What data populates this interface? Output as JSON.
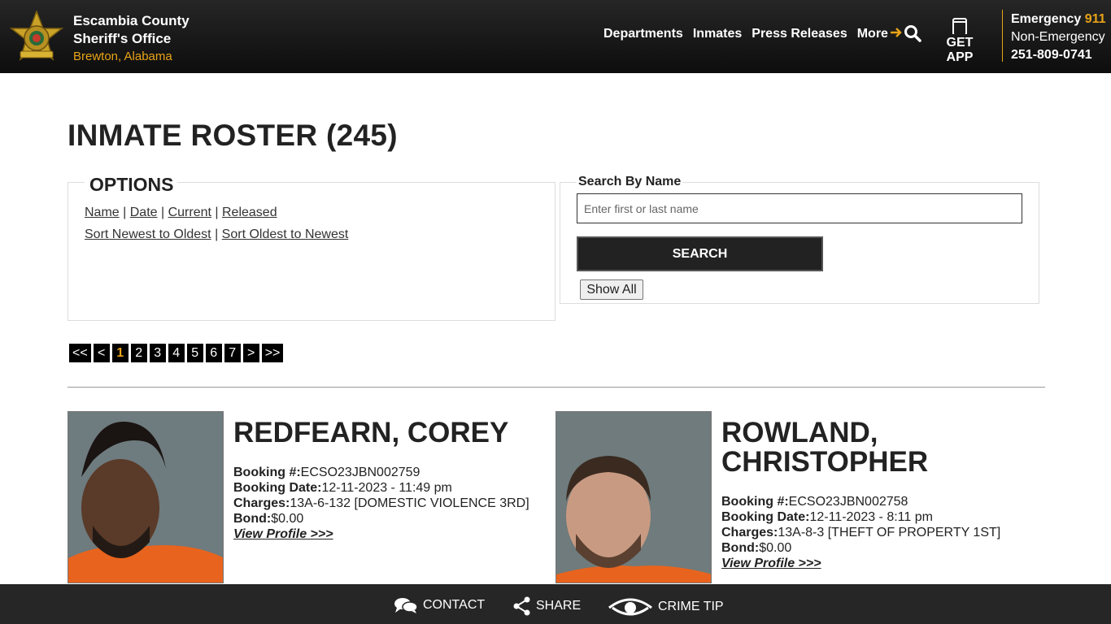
{
  "header": {
    "brand_line1": "Escambia County",
    "brand_line2": "Sheriff's Office",
    "brand_line3": "Brewton, Alabama",
    "nav": [
      "Departments",
      "Inmates",
      "Press Releases",
      "More"
    ],
    "get_app": "GET APP",
    "emergency_label": "Emergency",
    "emergency_number": "911",
    "non_emergency_label": "Non-Emergency",
    "non_emergency_number": "251-809-0741",
    "accent_color": "#e8a317"
  },
  "main": {
    "title": "INMATE ROSTER (245)",
    "options_title": "OPTIONS",
    "sort_links": [
      "Name",
      "Date",
      "Current",
      "Released"
    ],
    "order_links": [
      "Sort Newest to Oldest",
      "Sort Oldest to Newest"
    ],
    "search_label": "Search By Name",
    "search_placeholder": "Enter first or last name",
    "search_button": "SEARCH",
    "show_all_button": "Show All",
    "pager": [
      "<<",
      "<",
      "1",
      "2",
      "3",
      "4",
      "5",
      "6",
      "7",
      ">",
      ">>"
    ],
    "current_page": "1"
  },
  "inmates": [
    {
      "name": "REDFEARN, COREY",
      "booking_label": "Booking #:",
      "booking_no": "ECSO23JBN002759",
      "date_label": "Booking Date:",
      "booking_date": "12-11-2023 - 11:49 pm",
      "charges_label": "Charges:",
      "charges": "13A-6-132 [DOMESTIC VIOLENCE 3RD]",
      "bond_label": "Bond:",
      "bond": "$0.00",
      "view_profile": "View Profile >>>"
    },
    {
      "name_line1": "ROWLAND,",
      "name_line2": "CHRISTOPHER",
      "booking_label": "Booking #:",
      "booking_no": "ECSO23JBN002758",
      "date_label": "Booking Date:",
      "booking_date": "12-11-2023 - 8:11 pm",
      "charges_label": "Charges:",
      "charges": "13A-8-3 [THEFT OF PROPERTY 1ST]",
      "bond_label": "Bond:",
      "bond": "$0.00",
      "view_profile": "View Profile >>>"
    }
  ],
  "footer": {
    "contact": "CONTACT",
    "share": "SHARE",
    "crime_tip": "CRIME TIP"
  },
  "icons": [
    "sheriff-badge-icon",
    "arrow-right-icon",
    "search-icon",
    "phone-icon",
    "chat-bubble-icon",
    "share-icon",
    "eye-icon"
  ]
}
